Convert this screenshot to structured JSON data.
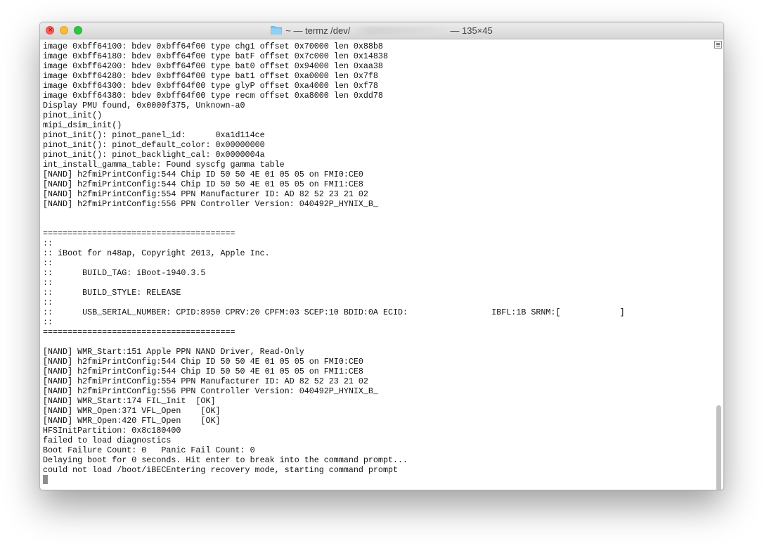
{
  "window": {
    "title_prefix": "~ — termz /dev/",
    "title_suffix": "— 135×45",
    "close_glyph": "×"
  },
  "icons": {
    "folder": "folder-icon",
    "scroll": "scroll-list-icon"
  },
  "colors": {
    "close": "#fc5f57",
    "minimize": "#fdbc2e",
    "zoom": "#28c840",
    "folder": "#7cc6ef"
  },
  "terminal": {
    "lines": [
      "image 0xbff64100: bdev 0xbff64f00 type chg1 offset 0x70000 len 0x88b8",
      "image 0xbff64180: bdev 0xbff64f00 type batF offset 0x7c000 len 0x14838",
      "image 0xbff64200: bdev 0xbff64f00 type bat0 offset 0x94000 len 0xaa38",
      "image 0xbff64280: bdev 0xbff64f00 type bat1 offset 0xa0000 len 0x7f8",
      "image 0xbff64300: bdev 0xbff64f00 type glyP offset 0xa4000 len 0xf78",
      "image 0xbff64380: bdev 0xbff64f00 type recm offset 0xa8000 len 0xdd78",
      "Display PMU found, 0x0000f375, Unknown-a0",
      "pinot_init()",
      "mipi_dsim_init()",
      "pinot_init(): pinot_panel_id:      0xa1d114ce",
      "pinot_init(): pinot_default_color: 0x00000000",
      "pinot_init(): pinot_backlight_cal: 0x0000004a",
      "int_install_gamma_table: Found syscfg gamma table",
      "[NAND] h2fmiPrintConfig:544 Chip ID 50 50 4E 01 05 05 on FMI0:CE0",
      "[NAND] h2fmiPrintConfig:544 Chip ID 50 50 4E 01 05 05 on FMI1:CE8",
      "[NAND] h2fmiPrintConfig:554 PPN Manufacturer ID: AD 82 52 23 21 02",
      "[NAND] h2fmiPrintConfig:556 PPN Controller Version: 040492P_HYNIX_B_",
      "",
      "",
      "=======================================",
      "::",
      ":: iBoot for n48ap, Copyright 2013, Apple Inc.",
      "::",
      "::      BUILD_TAG: iBoot-1940.3.5",
      "::",
      "::      BUILD_STYLE: RELEASE",
      "::",
      "::      USB_SERIAL_NUMBER: CPID:8950 CPRV:20 CPFM:03 SCEP:10 BDID:0A ECID:                 IBFL:1B SRNM:[            ]",
      "::",
      "=======================================",
      "",
      "[NAND] WMR_Start:151 Apple PPN NAND Driver, Read-Only",
      "[NAND] h2fmiPrintConfig:544 Chip ID 50 50 4E 01 05 05 on FMI0:CE0",
      "[NAND] h2fmiPrintConfig:544 Chip ID 50 50 4E 01 05 05 on FMI1:CE8",
      "[NAND] h2fmiPrintConfig:554 PPN Manufacturer ID: AD 82 52 23 21 02",
      "[NAND] h2fmiPrintConfig:556 PPN Controller Version: 040492P_HYNIX_B_",
      "[NAND] WMR_Start:174 FIL_Init  [OK]",
      "[NAND] WMR_Open:371 VFL_Open    [OK]",
      "[NAND] WMR_Open:420 FTL_Open    [OK]",
      "HFSInitPartition: 0x8c180400",
      "failed to load diagnostics",
      "Boot Failure Count: 0   Panic Fail Count: 0",
      "Delaying boot for 0 seconds. Hit enter to break into the command prompt...",
      "could not load /boot/iBECEntering recovery mode, starting command prompt"
    ]
  }
}
